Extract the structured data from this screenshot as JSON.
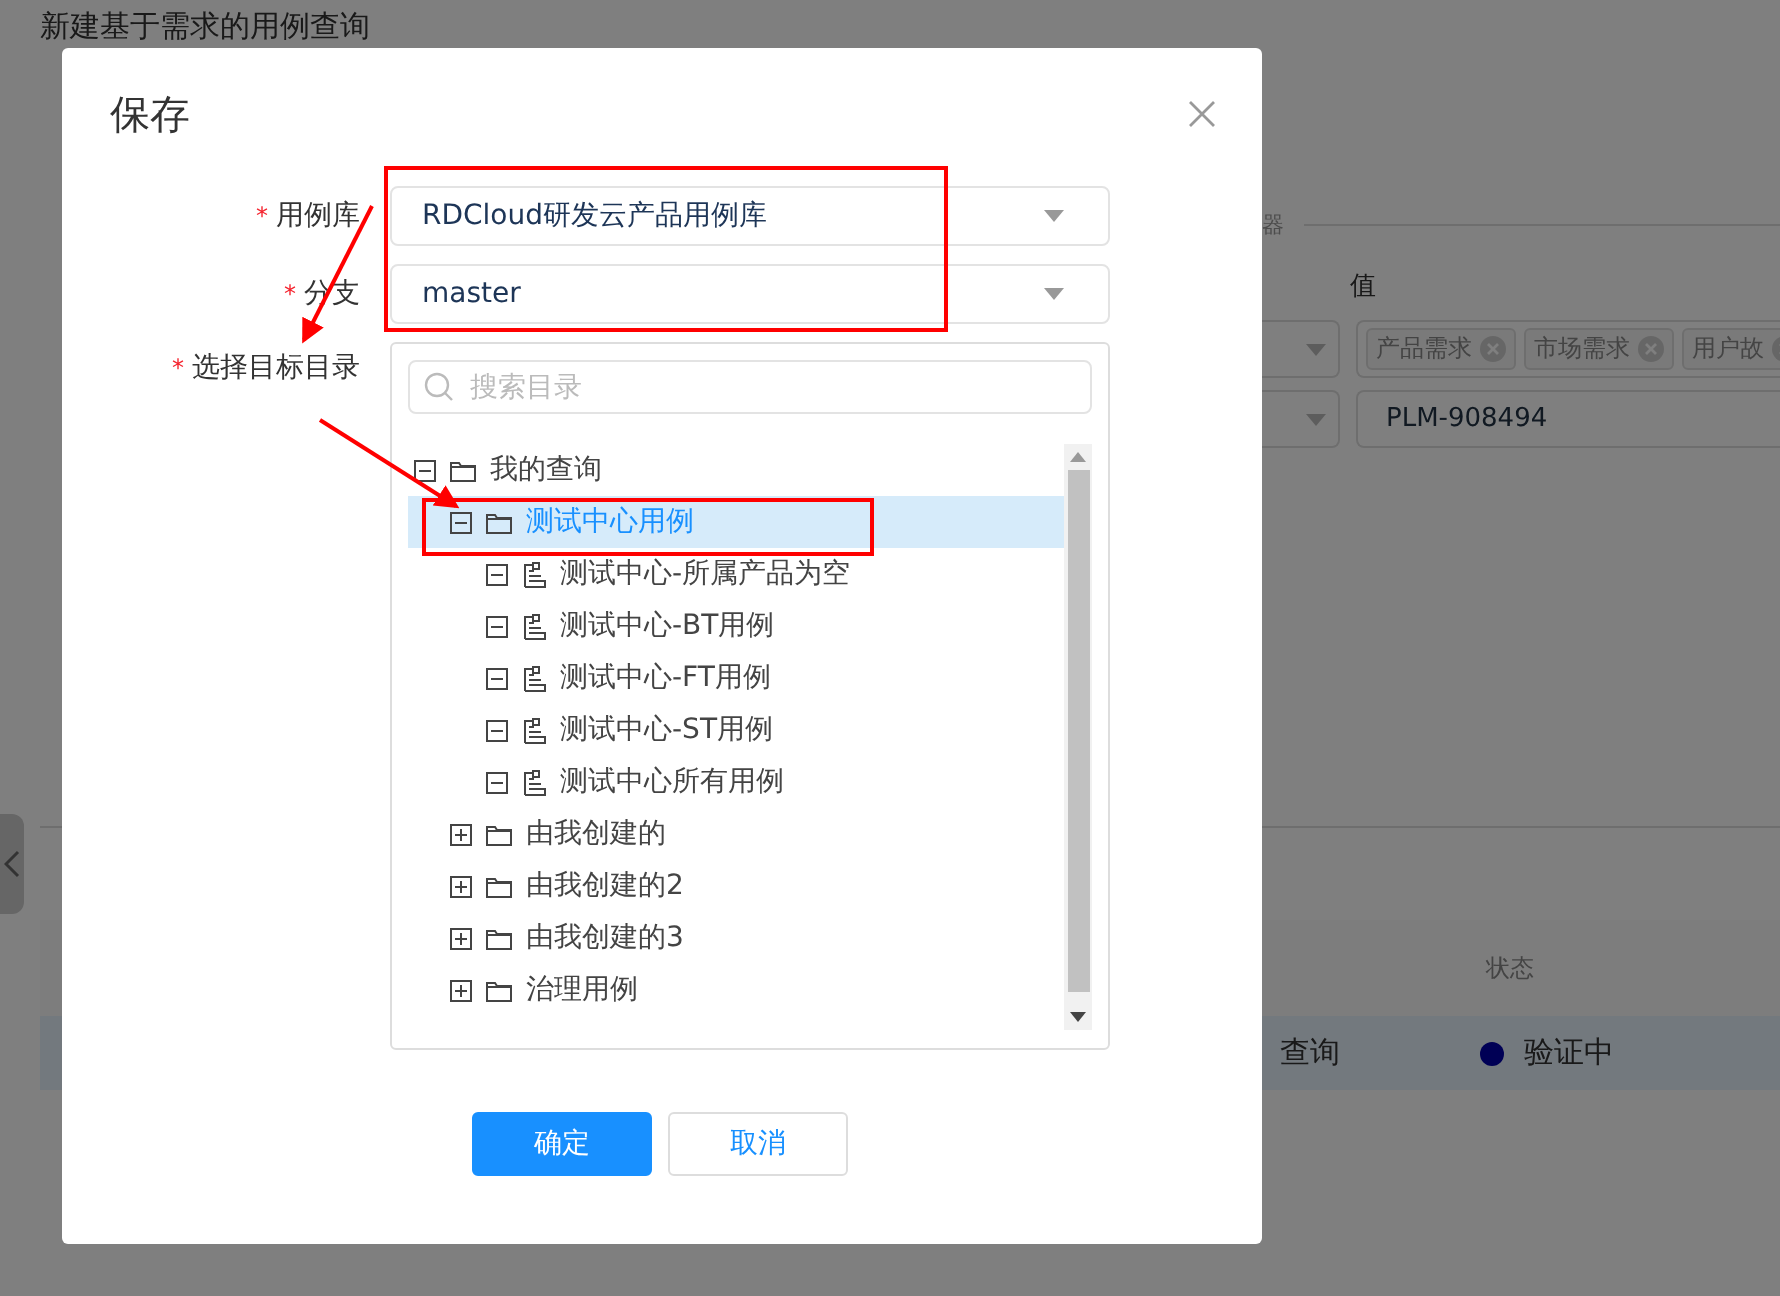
{
  "page": {
    "title": "新建基于需求的用例查询",
    "section_label": "器",
    "value_header": "值",
    "filters": [
      {
        "tags": [
          "产品需求",
          "市场需求",
          "用户故"
        ]
      },
      {
        "value": "PLM-908494"
      }
    ],
    "table": {
      "columns": [
        "状态"
      ],
      "rows": [
        {
          "name": "查询",
          "status": "验证中",
          "selected": true
        }
      ]
    }
  },
  "dialog": {
    "title": "保存",
    "fields": [
      {
        "label": "用例库",
        "required_mark": "*",
        "value": "RDCloud研发云产品用例库"
      },
      {
        "label": "分支",
        "required_mark": "*",
        "value": "master"
      }
    ],
    "tree_field": {
      "label": "选择目标目录",
      "required_mark": "*",
      "placeholder": "搜索目录",
      "tree": [
        {
          "label": "我的查询",
          "kind": "folder",
          "expanded": true,
          "selected": false,
          "children": [
            {
              "label": "测试中心用例",
              "kind": "folder",
              "expanded": true,
              "selected": true,
              "children": [
                {
                  "label": "测试中心-所属产品为空",
                  "kind": "query",
                  "expanded": true,
                  "selected": false
                },
                {
                  "label": "测试中心-BT用例",
                  "kind": "query",
                  "expanded": true,
                  "selected": false
                },
                {
                  "label": "测试中心-FT用例",
                  "kind": "query",
                  "expanded": true,
                  "selected": false
                },
                {
                  "label": "测试中心-ST用例",
                  "kind": "query",
                  "expanded": true,
                  "selected": false
                },
                {
                  "label": "测试中心所有用例",
                  "kind": "query",
                  "expanded": true,
                  "selected": false
                }
              ]
            },
            {
              "label": "由我创建的",
              "kind": "folder",
              "expanded": false,
              "selected": false
            },
            {
              "label": "由我创建的2",
              "kind": "folder",
              "expanded": false,
              "selected": false
            },
            {
              "label": "由我创建的3",
              "kind": "folder",
              "expanded": false,
              "selected": false
            },
            {
              "label": "治理用例",
              "kind": "folder",
              "expanded": false,
              "selected": false
            }
          ]
        }
      ]
    },
    "buttons": [
      {
        "label": "确定",
        "kind": "primary"
      },
      {
        "label": "取消",
        "kind": "default"
      }
    ]
  }
}
